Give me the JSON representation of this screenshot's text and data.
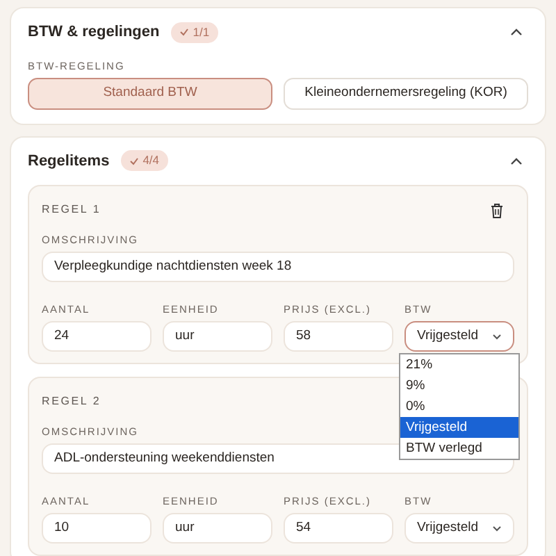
{
  "vat_section": {
    "title": "BTW & regelingen",
    "badge": "1/1",
    "expanded": true,
    "field_label": "BTW-REGELING",
    "options": [
      {
        "label": "Standaard BTW",
        "selected": true
      },
      {
        "label": "Kleineondernemersregeling (KOR)",
        "selected": false
      }
    ]
  },
  "items_section": {
    "title": "Regelitems",
    "badge": "4/4",
    "expanded": true,
    "lines": [
      {
        "title": "REGEL 1",
        "delete_visible": true,
        "description_label": "OMSCHRIJVING",
        "description": "Verpleegkundige nachtdiensten week 18",
        "fields": [
          {
            "label": "AANTAL",
            "value": "24"
          },
          {
            "label": "EENHEID",
            "value": "uur"
          },
          {
            "label": "PRIJS (EXCL.)",
            "value": "58"
          }
        ],
        "vat_label": "BTW",
        "vat_value": "Vrijgesteld",
        "open": true,
        "options": [
          {
            "label": "21%",
            "selected": false
          },
          {
            "label": "9%",
            "selected": false
          },
          {
            "label": "0%",
            "selected": false
          },
          {
            "label": "Vrijgesteld",
            "selected": true
          },
          {
            "label": "BTW verlegd",
            "selected": false
          }
        ]
      },
      {
        "title": "REGEL 2",
        "delete_visible": false,
        "description_label": "OMSCHRIJVING",
        "description": "ADL-ondersteuning weekenddiensten",
        "fields": [
          {
            "label": "AANTAL",
            "value": "10"
          },
          {
            "label": "EENHEID",
            "value": "uur"
          },
          {
            "label": "PRIJS (EXCL.)",
            "value": "54"
          }
        ],
        "vat_label": "BTW",
        "vat_value": "Vrijgesteld",
        "open": false
      }
    ]
  }
}
